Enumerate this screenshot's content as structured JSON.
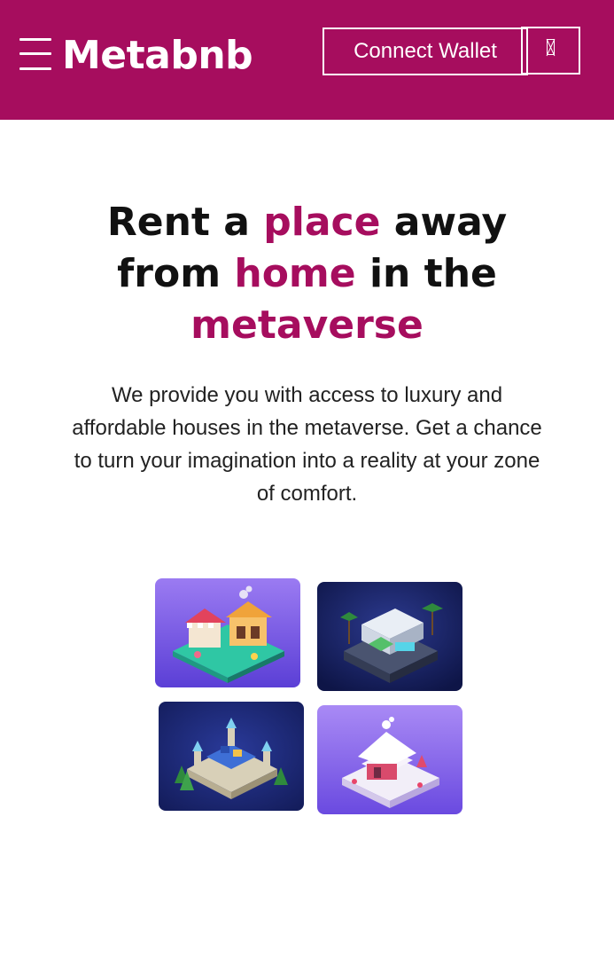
{
  "header": {
    "brand": "Metabnb",
    "connect_label": "Connect Wallet",
    "background_color": "#a60d5e",
    "menu_icon": "hamburger-icon",
    "close_icon": "close-icon"
  },
  "hero": {
    "title_parts": [
      "Rent a ",
      "place",
      " away from ",
      "home",
      " in the ",
      "metaverse"
    ],
    "accent_color": "#a60d5e",
    "description": "We provide you with access to luxury and affordable houses in the metaverse. Get a chance to turn your imagination into a reality at your zone of comfort."
  },
  "gallery": {
    "tiles": [
      {
        "icon": "market-stall-illustration"
      },
      {
        "icon": "modern-villa-illustration"
      },
      {
        "icon": "castle-illustration"
      },
      {
        "icon": "snow-cottage-illustration"
      }
    ]
  }
}
